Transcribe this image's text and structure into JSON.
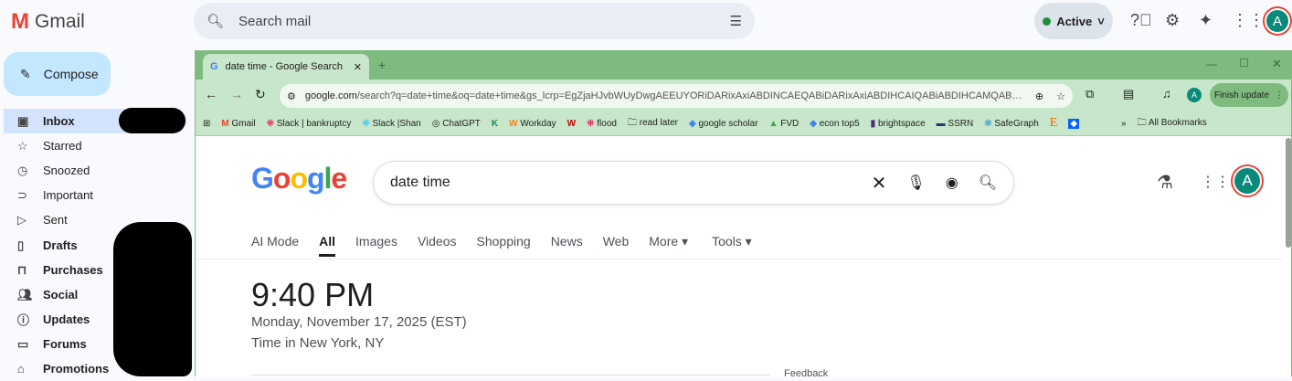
{
  "gmail": {
    "title": "Gmail",
    "search_placeholder": "Search mail",
    "status": "Active",
    "avatar": "A",
    "compose": "Compose",
    "nav": [
      "Inbox",
      "Starred",
      "Snoozed",
      "Important",
      "Sent",
      "Drafts",
      "Purchases",
      "Social",
      "Updates",
      "Forums",
      "Promotions"
    ]
  },
  "chrome": {
    "tab_title": "date time - Google Search",
    "url_domain": "google.com",
    "url_path": "/search?q=date+time&oq=date+time&gs_lcrp=EgZjaHJvbWUyDwgAEEUYORiDARixAxiABDINCAEQABiDARixAxiABDIHCAIQABiABDIHCAMQABiABDI...",
    "profile": "A",
    "finish_update": "Finish update",
    "bookmarks": [
      "Gmail",
      "Slack | bankruptcy",
      "Slack |Shan",
      "ChatGPT",
      "K",
      "Workday",
      "flood",
      "read later",
      "google scholar",
      "FVD",
      "econ top5",
      "brightspace",
      "SSRN",
      "SafeGraph"
    ],
    "all_bookmarks": "All Bookmarks"
  },
  "google": {
    "logo": "Google",
    "query": "date time",
    "tabs": [
      "AI Mode",
      "All",
      "Images",
      "Videos",
      "Shopping",
      "News",
      "Web",
      "More ▾",
      "Tools ▾"
    ],
    "time": "9:40 PM",
    "date": "Monday, November 17, 2025 (EST)",
    "place": "Time in New York, NY",
    "feedback": "Feedback",
    "avatar": "A"
  }
}
